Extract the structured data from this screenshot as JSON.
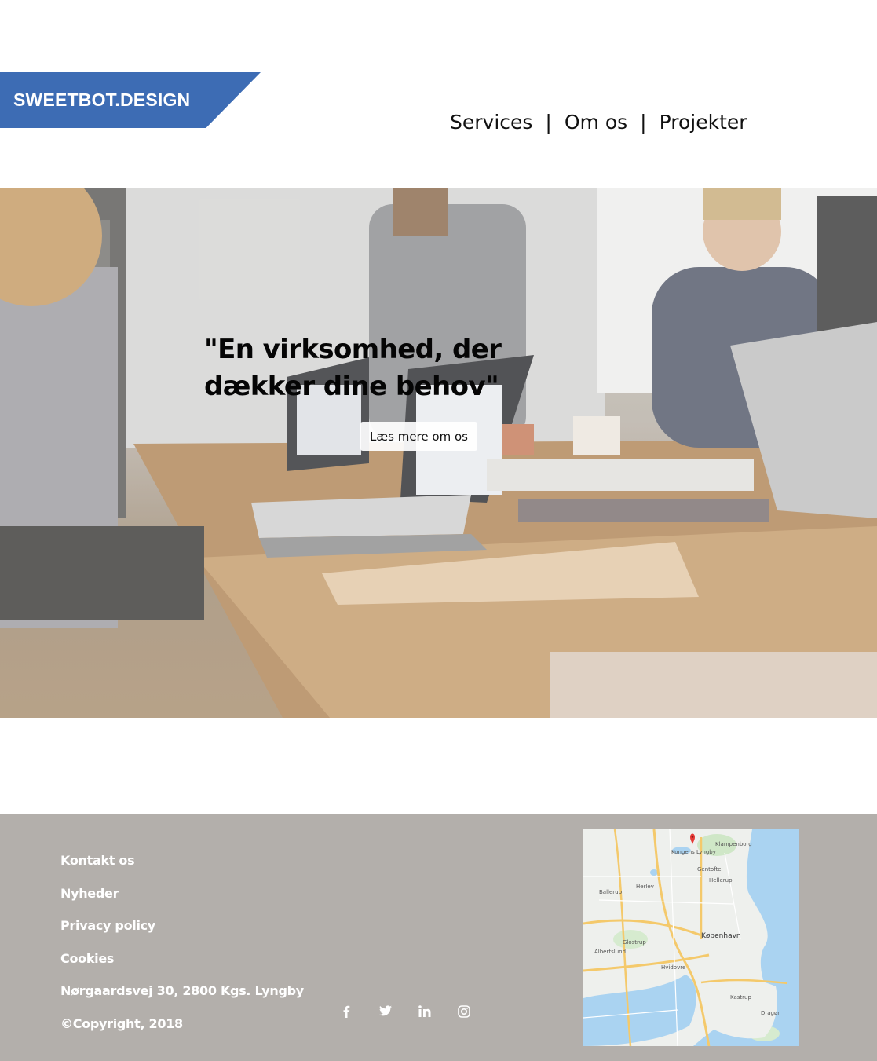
{
  "header": {
    "logo_text": "SWEETBOT.DESIGN",
    "nav": [
      {
        "label": "Services"
      },
      {
        "label": "Om os"
      },
      {
        "label": "Projekter"
      }
    ],
    "separator": "|"
  },
  "hero": {
    "quote": "\"En virksomhed, der dækker dine behov\"",
    "button_label": "Læs mere om os"
  },
  "footer": {
    "links": [
      {
        "label": "Kontakt os"
      },
      {
        "label": "Nyheder"
      },
      {
        "label": "Privacy policy"
      },
      {
        "label": "Cookies"
      }
    ],
    "address": "Nørgaardsvej 30, 2800 Kgs. Lyngby",
    "copyright": "©Copyright, 2018",
    "social_icons": [
      "facebook-icon",
      "twitter-icon",
      "linkedin-icon",
      "instagram-icon"
    ],
    "map": {
      "labels": [
        "Klampenborg",
        "Kongens Lyngby",
        "Gentofte",
        "Hellerup",
        "Herlev",
        "Ballerup",
        "København",
        "Glostrup",
        "Albertslund",
        "Hvidovre",
        "Kastrup",
        "Dragør"
      ]
    }
  },
  "colors": {
    "brand_blue": "#3d6cb4",
    "footer_bg": "#b3afab",
    "map_water": "#aad3f1"
  }
}
